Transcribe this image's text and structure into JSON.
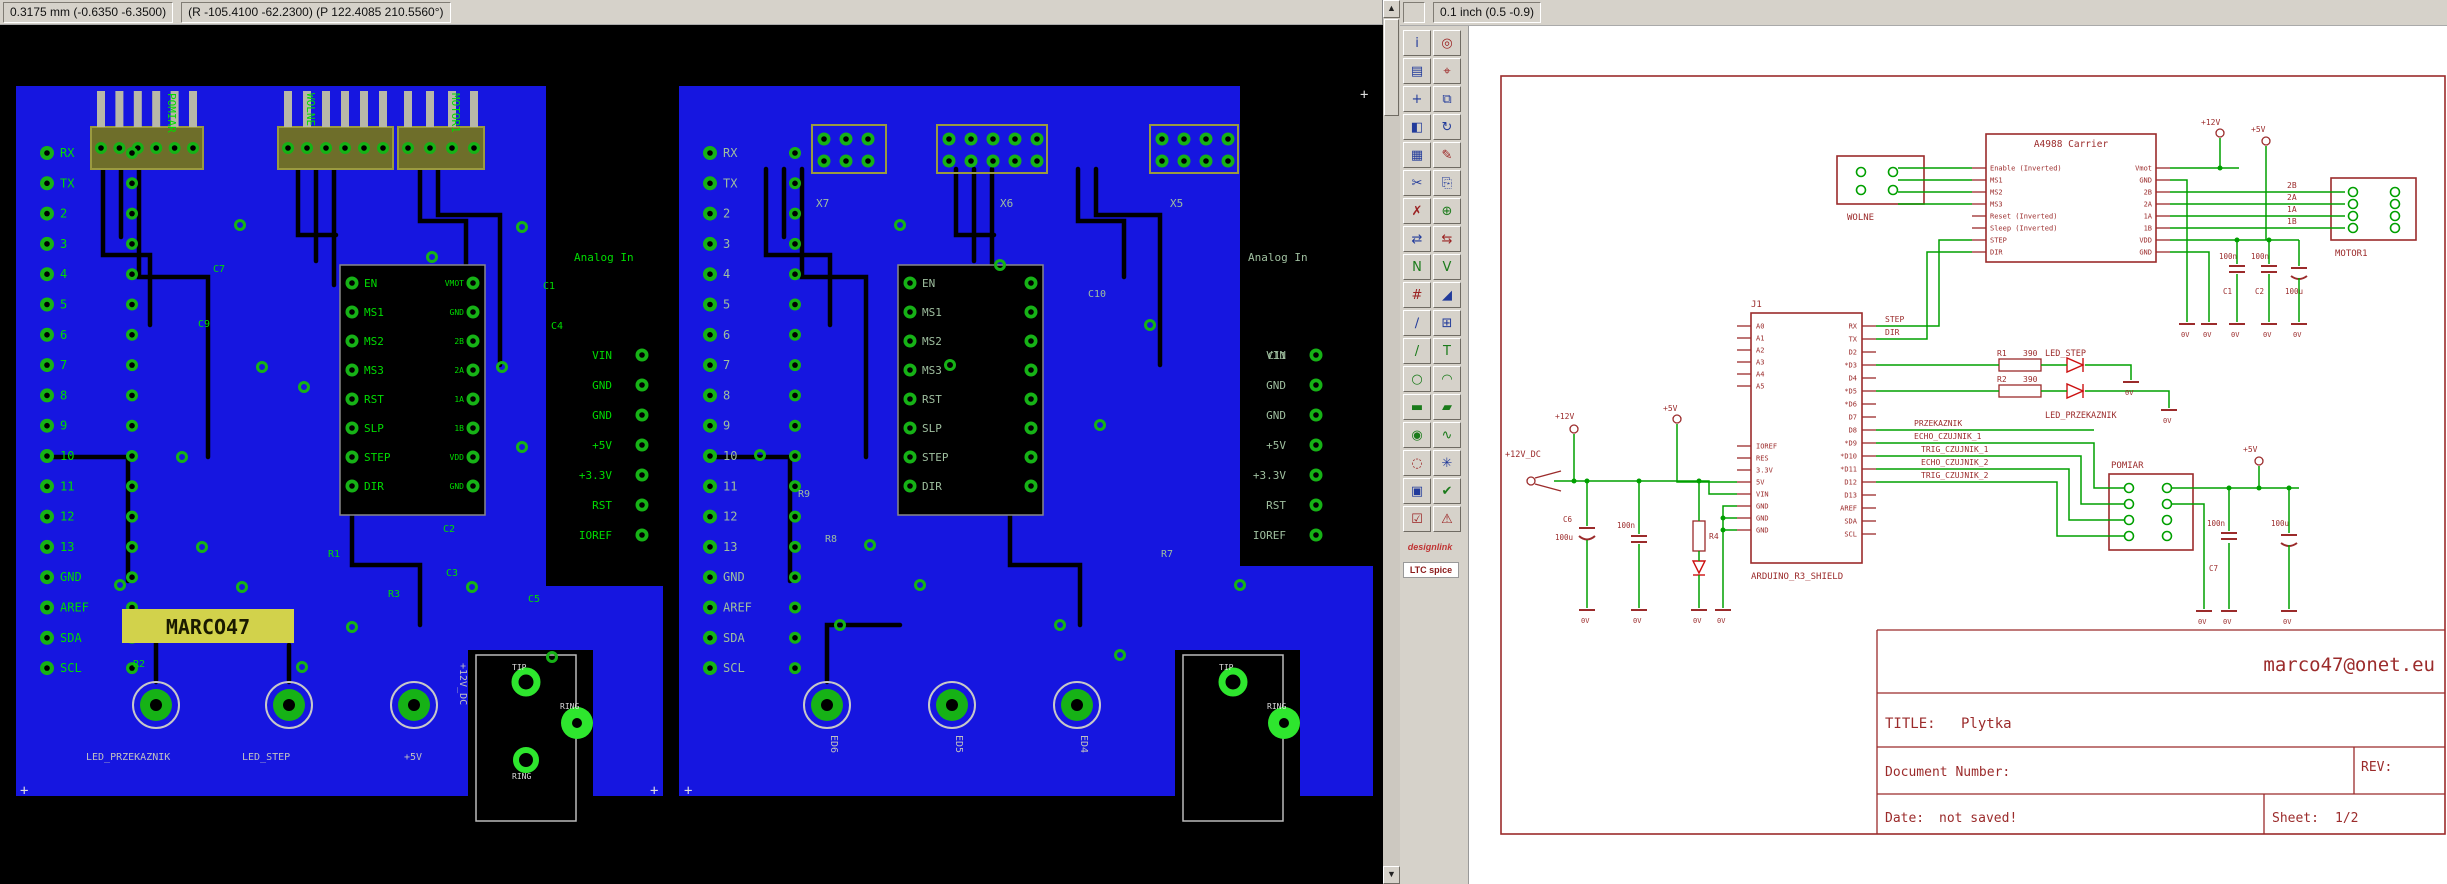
{
  "window": {
    "left_status": {
      "grid": "0.3175 mm (-0.6350 -6.3500)",
      "cursor": "(R -105.4100 -62.2300) (P 122.4085 210.5560°)"
    },
    "right_status": {
      "cursor": "0.1 inch (0.5 -0.9)"
    }
  },
  "toolbar": {
    "tools": [
      {
        "name": "info",
        "glyph": "i",
        "color": "#223b9b"
      },
      {
        "name": "show",
        "glyph": "◎",
        "color": "#9b2222"
      },
      {
        "name": "display",
        "glyph": "▤",
        "color": "#223b9b"
      },
      {
        "name": "mark",
        "glyph": "⌖",
        "color": "#9b2222"
      },
      {
        "name": "move",
        "glyph": "+",
        "color": "#223b9b"
      },
      {
        "name": "copy",
        "glyph": "⧉",
        "color": "#223b9b"
      },
      {
        "name": "mirror",
        "glyph": "◧",
        "color": "#223b9b"
      },
      {
        "name": "rotate",
        "glyph": "↻",
        "color": "#223b9b"
      },
      {
        "name": "group",
        "glyph": "▦",
        "color": "#223b9b"
      },
      {
        "name": "change",
        "glyph": "✎",
        "color": "#9b2222"
      },
      {
        "name": "cut",
        "glyph": "✂",
        "color": "#223b9b"
      },
      {
        "name": "paste",
        "glyph": "⎘",
        "color": "#223b9b"
      },
      {
        "name": "delete",
        "glyph": "✗",
        "color": "#9b2222"
      },
      {
        "name": "add",
        "glyph": "⊕",
        "color": "#1b7b1b"
      },
      {
        "name": "pinswap",
        "glyph": "⇄",
        "color": "#223b9b"
      },
      {
        "name": "replace",
        "glyph": "⇆",
        "color": "#9b2222"
      },
      {
        "name": "name",
        "glyph": "N",
        "color": "#1b7b1b"
      },
      {
        "name": "value",
        "glyph": "V",
        "color": "#1b7b1b"
      },
      {
        "name": "smash",
        "glyph": "#",
        "color": "#9b2222"
      },
      {
        "name": "miter",
        "glyph": "◢",
        "color": "#223b9b"
      },
      {
        "name": "split",
        "glyph": "∕",
        "color": "#223b9b"
      },
      {
        "name": "invoke",
        "glyph": "⊞",
        "color": "#223b9b"
      },
      {
        "name": "wire",
        "glyph": "/",
        "color": "#1b7b1b"
      },
      {
        "name": "text",
        "glyph": "T",
        "color": "#1b7b1b"
      },
      {
        "name": "circle",
        "glyph": "○",
        "color": "#1b7b1b"
      },
      {
        "name": "arc",
        "glyph": "◠",
        "color": "#1b7b1b"
      },
      {
        "name": "rect",
        "glyph": "▬",
        "color": "#1b7b1b"
      },
      {
        "name": "polygon",
        "glyph": "▰",
        "color": "#1b7b1b"
      },
      {
        "name": "via",
        "glyph": "◉",
        "color": "#1b7b1b"
      },
      {
        "name": "signal",
        "glyph": "∿",
        "color": "#1b7b1b"
      },
      {
        "name": "hole",
        "glyph": "◌",
        "color": "#9b2222"
      },
      {
        "name": "ratsnest",
        "glyph": "✳",
        "color": "#223b9b"
      },
      {
        "name": "auto",
        "glyph": "▣",
        "color": "#223b9b"
      },
      {
        "name": "erc",
        "glyph": "✔",
        "color": "#1b7b1b"
      },
      {
        "name": "drc",
        "glyph": "☑",
        "color": "#9b2222"
      },
      {
        "name": "errors",
        "glyph": "⚠",
        "color": "#9b2222"
      }
    ],
    "logos": [
      {
        "name": "designlink",
        "text": "designlink"
      },
      {
        "name": "ltc-spice",
        "text": "LTC spice"
      }
    ]
  },
  "board": {
    "board1": {
      "left_pins": [
        "RX",
        "TX",
        "2",
        "3",
        "4",
        "5",
        "6",
        "7",
        "8",
        "9",
        "10",
        "11",
        "12",
        "13",
        "GND",
        "AREF",
        "SDA",
        "SCL"
      ],
      "headers": [
        "POMIAR",
        "WOLNE",
        "MOTOR1"
      ],
      "ic_pins_left": [
        "EN",
        "MS1",
        "MS2",
        "MS3",
        "RST",
        "SLP",
        "STEP",
        "DIR"
      ],
      "ic_pins_right": [
        "VMOT",
        "GND",
        "2B",
        "2A",
        "1A",
        "1B",
        "VDD",
        "GND"
      ],
      "analog_in": "Analog In",
      "right_labels": [
        "VIN",
        "GND",
        "GND",
        "+5V",
        "+3.3V",
        "RST",
        "IOREF"
      ],
      "refs": [
        "C7",
        "C9",
        "C1",
        "C4",
        "C2",
        "C3",
        "C5",
        "R1",
        "R2",
        "R3"
      ],
      "board_name": "MARCO47",
      "bottom_labels": [
        "LED_PRZEKAZNIK",
        "LED_STEP",
        "+5V"
      ],
      "jack_labels": [
        "TIP",
        "RING",
        "RING"
      ],
      "jack_power": "+12V_DC"
    },
    "board2": {
      "left_pins": [
        "RX",
        "TX",
        "2",
        "3",
        "4",
        "5",
        "6",
        "7",
        "8",
        "9",
        "10",
        "11",
        "12",
        "13",
        "GND",
        "AREF",
        "SDA",
        "SCL"
      ],
      "headers": [
        "X7",
        "X6",
        "X5"
      ],
      "ic_pins_left": [
        "EN",
        "MS1",
        "MS2",
        "MS3",
        "RST",
        "SLP",
        "STEP",
        "DIR"
      ],
      "analog_in": "Analog In",
      "right_labels": [
        "VIN",
        "GND",
        "GND",
        "+5V",
        "+3.3V",
        "RST",
        "IOREF"
      ],
      "refs": [
        "C10",
        "C11",
        "R9",
        "R8",
        "R7"
      ],
      "bottom_labels": [
        "ED6",
        "ED5",
        "ED4"
      ],
      "jack_labels": [
        "TIP",
        "RING"
      ]
    }
  },
  "schematic": {
    "a4988": {
      "title": "A4988 Carrier",
      "left_pins": [
        "Enable (Inverted)",
        "MS1",
        "MS2",
        "MS3",
        "Reset (Inverted)",
        "Sleep (Inverted)",
        "STEP",
        "DIR"
      ],
      "right_pins": [
        "Vmot",
        "GND",
        "2B",
        "2A",
        "1A",
        "1B",
        "VDD",
        "GND"
      ]
    },
    "wolne_label": "WOLNE",
    "motor1_label": "MOTOR1",
    "motor_nets": [
      "2B",
      "2A",
      "1A",
      "1B"
    ],
    "shield": {
      "ref": "J1",
      "name": "ARDUINO_R3_SHIELD",
      "left_pins_analog": [
        "A0",
        "A1",
        "A2",
        "A3",
        "A4",
        "A5"
      ],
      "left_pins_power": [
        "IOREF",
        "RES",
        "3.3V",
        "5V",
        "VIN",
        "GND",
        "GND",
        "GND"
      ],
      "right_pins": [
        "RX",
        "TX",
        "D2",
        "*D3",
        "D4",
        "*D5",
        "*D6",
        "D7",
        "D8",
        "*D9",
        "*D10",
        "*D11",
        "D12",
        "D13",
        "AREF",
        "SDA",
        "SCL"
      ]
    },
    "pomiar_label": "POMIAR",
    "nets": {
      "step": "STEP",
      "dir": "DIR",
      "przekaznik": "PRZEKAZNIK",
      "echo1": "ECHO_CZUJNIK_1",
      "trig1": "TRIG_CZUJNIK_1",
      "echo2": "ECHO_CZUJNIK_2",
      "trig2": "TRIG_CZUJNIK_2"
    },
    "leds": {
      "step": "LED_STEP",
      "przekaznik": "LED_PRZEKAZNIK"
    },
    "parts": {
      "r1": "R1",
      "r1_value": "390",
      "r2": "R2",
      "r2_value": "390",
      "r4": "R4",
      "c1": "C1",
      "c2": "C2",
      "c6": "C6",
      "c7": "C7",
      "v100n": "100n",
      "v100u": "100u"
    },
    "power": {
      "p12": "+12V",
      "p5": "+5V",
      "p12dc": "+12V_DC",
      "gnd": "0V"
    },
    "titleblock": {
      "email": "marco47@onet.eu",
      "title_label": "TITLE:",
      "title": "Plytka",
      "doc_label": "Document Number:",
      "rev_label": "REV:",
      "date_label": "Date:",
      "date": "not saved!",
      "sheet_label": "Sheet:",
      "sheet": "1/2"
    }
  }
}
